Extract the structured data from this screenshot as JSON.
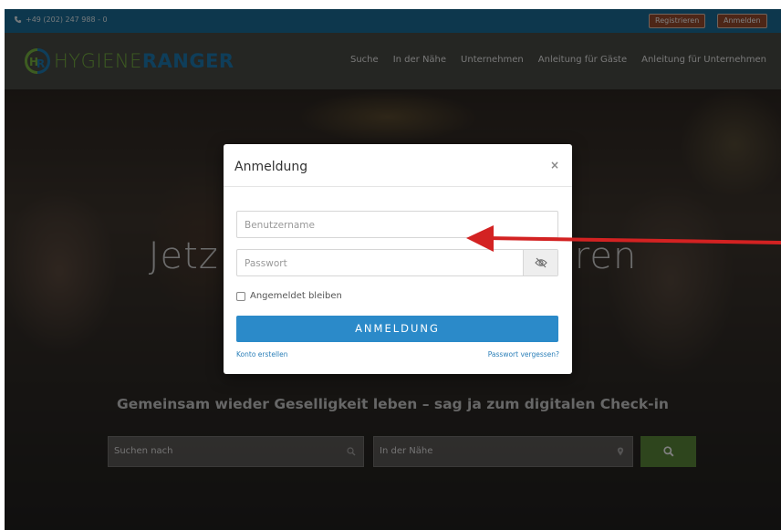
{
  "topbar": {
    "phone": "+49 (202) 247 988 - 0",
    "register_label": "Registrieren",
    "login_label": "Anmelden"
  },
  "logo": {
    "text_a": "HYGIENE",
    "text_b": "RANGER",
    "mark": "HR"
  },
  "nav": {
    "items": [
      "Suche",
      "In der Nähe",
      "Unternehmen",
      "Anleitung für Gäste",
      "Anleitung für Unternehmen"
    ]
  },
  "hero": {
    "title_left": "Jetz",
    "title_right": "ren",
    "subtitle": "Gemeinsam wieder Geselligkeit leben – sag ja zum digitalen Check-in",
    "search_placeholder": "Suchen nach",
    "near_placeholder": "In der Nähe"
  },
  "modal": {
    "title": "Anmeldung",
    "close": "×",
    "username_placeholder": "Benutzername",
    "password_placeholder": "Passwort",
    "remember_label": "Angemeldet bleiben",
    "submit_label": "ANMELDUNG",
    "create_account": "Konto erstellen",
    "forgot_password": "Passwort vergessen?"
  },
  "icons": {
    "phone": "phone-icon",
    "eye": "eye-slash-icon",
    "search": "search-icon",
    "location": "map-pin-icon"
  },
  "colors": {
    "topbar": "#1b6f9a",
    "brand_green": "#7ab843",
    "brand_blue": "#1e7db4",
    "primary_button": "#2b8ac9",
    "annotation_arrow": "#d32222"
  }
}
